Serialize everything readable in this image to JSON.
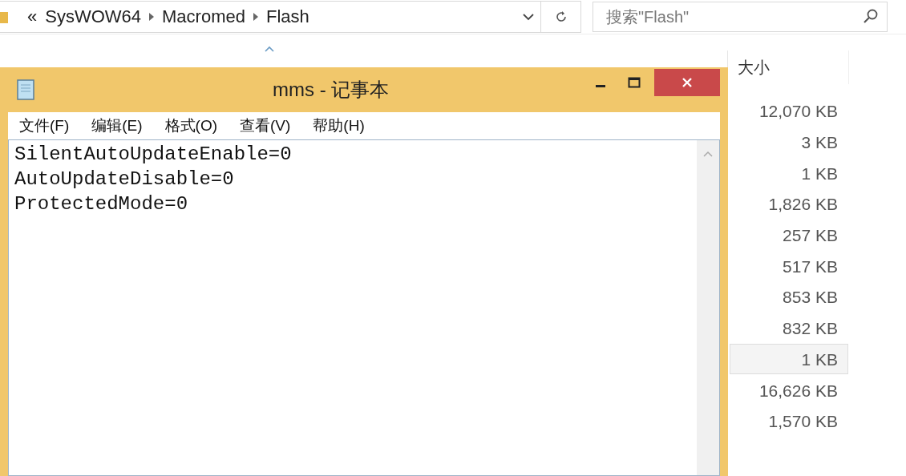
{
  "explorer": {
    "address_bar": {
      "overflow": "«",
      "path": [
        "SysWOW64",
        "Macromed",
        "Flash"
      ]
    },
    "search": {
      "placeholder": "搜索\"Flash\""
    },
    "columns": [
      {
        "label": "大小"
      }
    ],
    "rows": [
      {
        "size": "12,070 KB",
        "selected": false
      },
      {
        "size": "3 KB",
        "selected": false
      },
      {
        "size": "1 KB",
        "selected": false
      },
      {
        "size": "1,826 KB",
        "selected": false
      },
      {
        "size": "257 KB",
        "selected": false
      },
      {
        "size": "517 KB",
        "selected": false
      },
      {
        "size": "853 KB",
        "selected": false
      },
      {
        "size": "832 KB",
        "selected": false
      },
      {
        "size": "1 KB",
        "selected": true
      },
      {
        "size": "16,626 KB",
        "selected": false
      },
      {
        "size": "1,570 KB",
        "selected": false
      }
    ]
  },
  "notepad": {
    "title": "mms - 记事本",
    "menu": [
      "文件(F)",
      "编辑(E)",
      "格式(O)",
      "查看(V)",
      "帮助(H)"
    ],
    "lines": [
      "SilentAutoUpdateEnable=0",
      "AutoUpdateDisable=0",
      "ProtectedMode=0"
    ]
  }
}
